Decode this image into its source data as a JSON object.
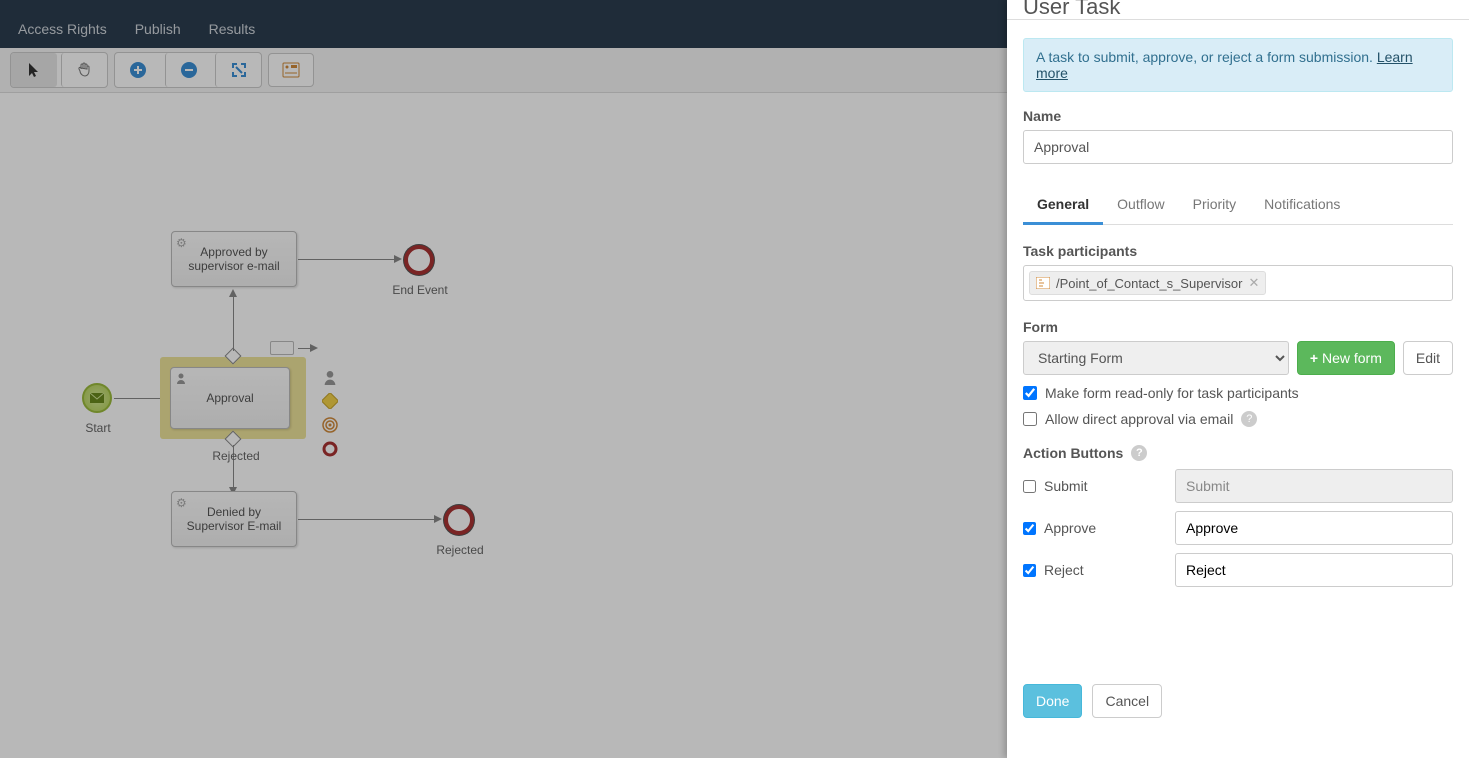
{
  "nav": {
    "access": "Access Rights",
    "publish": "Publish",
    "results": "Results"
  },
  "diagram": {
    "start": "Start",
    "approval": "Approval",
    "approved_email": "Approved by supervisor e-mail",
    "denied_email": "Denied by Supervisor E-mail",
    "end_event": "End Event",
    "rejected_label": "Rejected",
    "rejected_end": "Rejected"
  },
  "panel": {
    "title": "User Task",
    "info_text": "A task to submit, approve, or reject a form submission. ",
    "info_link": "Learn more",
    "name_label": "Name",
    "name_value": "Approval",
    "tabs": {
      "general": "General",
      "outflow": "Outflow",
      "priority": "Priority",
      "notifications": "Notifications"
    },
    "participants_label": "Task participants",
    "participant_token": "/Point_of_Contact_s_Supervisor",
    "form_label": "Form",
    "form_select": "Starting Form",
    "new_form": " New form",
    "edit_form": "Edit",
    "readonly_label": "Make form read-only for task participants",
    "direct_approval_label": "Allow direct approval via email",
    "action_buttons_label": "Action Buttons",
    "actions": {
      "submit": {
        "label": "Submit",
        "value": "Submit",
        "checked": false
      },
      "approve": {
        "label": "Approve",
        "value": "Approve",
        "checked": true
      },
      "reject": {
        "label": "Reject",
        "value": "Reject",
        "checked": true
      }
    },
    "done": "Done",
    "cancel": "Cancel"
  }
}
